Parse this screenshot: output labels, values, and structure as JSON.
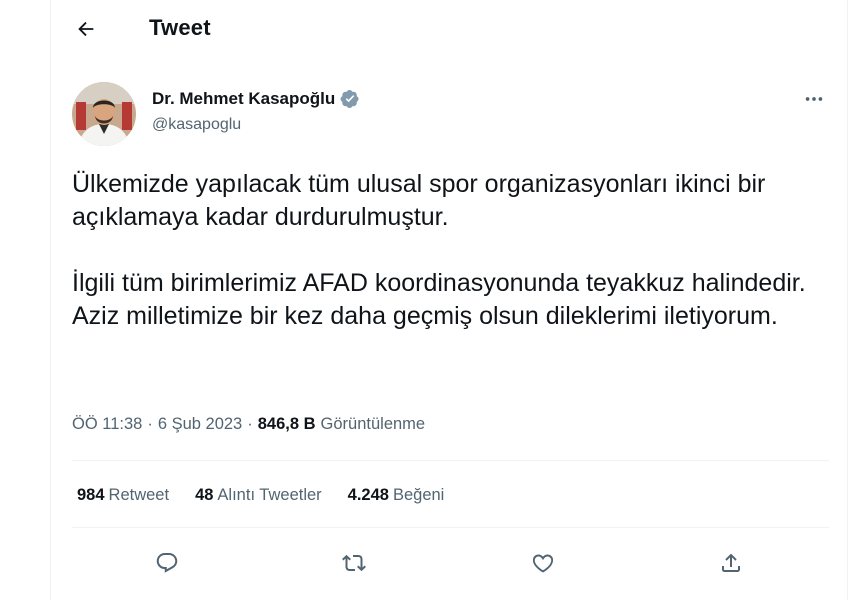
{
  "header": {
    "title": "Tweet"
  },
  "author": {
    "display_name": "Dr. Mehmet Kasapoğlu",
    "handle": "@kasapoglu",
    "verified": true
  },
  "tweet": {
    "text": "Ülkemizde yapılacak tüm ulusal spor organizasyonları ikinci bir açıklamaya kadar durdurulmuştur.\n\nİlgili tüm birimlerimiz AFAD koordinasyonunda teyakkuz halindedir. Aziz milletimize bir kez daha geçmiş olsun dileklerimi iletiyorum."
  },
  "meta": {
    "time": "ÖÖ 11:38",
    "date": "6 Şub 2023",
    "separator": "·",
    "views_count": "846,8 B",
    "views_label": "Görüntülenme"
  },
  "stats": {
    "retweets": {
      "count": "984",
      "label": "Retweet"
    },
    "quotes": {
      "count": "48",
      "label": "Alıntı Tweetler"
    },
    "likes": {
      "count": "4.248",
      "label": "Beğeni"
    }
  },
  "icons": {
    "back": "arrow-left-icon",
    "verified": "verified-badge-icon",
    "more": "more-dots-icon",
    "reply": "reply-icon",
    "retweet": "retweet-icon",
    "like": "heart-icon",
    "share": "share-icon"
  },
  "colors": {
    "text_primary": "#0f1419",
    "text_secondary": "#536471",
    "verified": "#829aab",
    "divider": "#eff3f4"
  }
}
